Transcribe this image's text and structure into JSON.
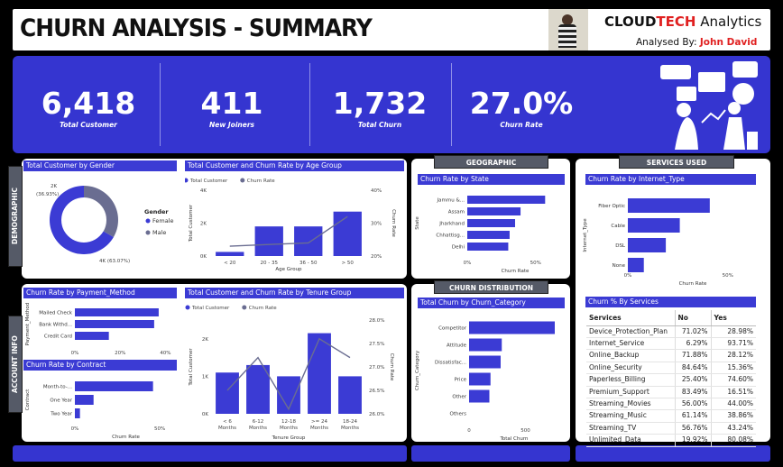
{
  "header": {
    "title": "CHURN ANALYSIS - SUMMARY",
    "brand_a": "CLOUD",
    "brand_b": "TECH",
    "brand_c": " Analytics",
    "analysed_by": "Analysed By: ",
    "analyst": "John David"
  },
  "kpis": [
    {
      "value": "6,418",
      "label": "Total Customer"
    },
    {
      "value": "411",
      "label": "New Joiners"
    },
    {
      "value": "1,732",
      "label": "Total Churn"
    },
    {
      "value": "27.0%",
      "label": "Churn Rate"
    }
  ],
  "sections": {
    "demographic": "DEMOGRAPHIC",
    "account_info": "ACCOUNT INFO",
    "geographic": "GEOGRAPHIC",
    "services_used": "SERVICES USED",
    "churn_distribution": "CHURN DISTRIBUTION"
  },
  "colors": {
    "primary": "#3b3bd4",
    "secondary": "#6a6d91",
    "header_text": "#111111",
    "accent_red": "#e02020"
  },
  "chart_data": [
    {
      "id": "gender",
      "type": "pie",
      "title": "Total Customer by Gender",
      "legend_title": "Gender",
      "categories": [
        "Female",
        "Male"
      ],
      "values": [
        4000,
        2000
      ],
      "percents": [
        "63.07%",
        "36.93%"
      ],
      "labels": [
        "4K (63.07%)",
        "2K (36.93%)"
      ]
    },
    {
      "id": "age",
      "type": "bar",
      "title": "Total Customer and Churn Rate by Age Group",
      "legend": [
        "Total Customer",
        "Churn Rate"
      ],
      "xlabel": "Age Group",
      "ylabel": "Total Customer",
      "y2label": "Churn Rate",
      "categories": [
        "< 20",
        "20 - 35",
        "36 - 50",
        "> 50"
      ],
      "series": [
        {
          "name": "Total Customer",
          "values": [
            250,
            1800,
            1800,
            2700
          ]
        },
        {
          "name": "Churn Rate",
          "values": [
            23,
            23.5,
            24,
            32
          ]
        }
      ],
      "ylim": [
        0,
        4000
      ],
      "yticks": [
        "0K",
        "2K",
        "4K"
      ],
      "y2lim": [
        20,
        40
      ],
      "y2ticks": [
        "20%",
        "30%",
        "40%"
      ]
    },
    {
      "id": "state",
      "type": "bar",
      "orientation": "horizontal",
      "title": "Churn Rate by State",
      "xlabel": "Churn Rate",
      "ylabel": "State",
      "categories": [
        "Jammu &...",
        "Assam",
        "Jharkhand",
        "Chhattisg...",
        "Delhi"
      ],
      "values": [
        57,
        39,
        35,
        31,
        30
      ],
      "xlim": [
        0,
        70
      ],
      "xticks": [
        "0%",
        "50%"
      ]
    },
    {
      "id": "internet",
      "type": "bar",
      "orientation": "horizontal",
      "title": "Churn Rate by Internet_Type",
      "xlabel": "Churn Rate",
      "ylabel": "Internet_Type",
      "categories": [
        "Fiber Optic",
        "Cable",
        "DSL",
        "None"
      ],
      "values": [
        41,
        26,
        19,
        8
      ],
      "xlim": [
        0,
        65
      ],
      "xticks": [
        "0%",
        "50%"
      ]
    },
    {
      "id": "payment",
      "type": "bar",
      "orientation": "horizontal",
      "title": "Churn Rate by Payment_Method",
      "ylabel": "Payment_Method",
      "categories": [
        "Mailed Check",
        "Bank Withd...",
        "Credit Card"
      ],
      "values": [
        37,
        35,
        15
      ],
      "xlim": [
        0,
        45
      ],
      "xticks": [
        "0%",
        "20%",
        "40%"
      ]
    },
    {
      "id": "contract",
      "type": "bar",
      "orientation": "horizontal",
      "title": "Churn Rate by Contract",
      "xlabel": "Churn Rate",
      "ylabel": "Contract",
      "categories": [
        "Month-to-...",
        "One Year",
        "Two Year"
      ],
      "values": [
        46,
        11,
        3
      ],
      "xlim": [
        0,
        60
      ],
      "xticks": [
        "0%",
        "50%"
      ]
    },
    {
      "id": "tenure",
      "type": "bar",
      "title": "Total Customer and Churn Rate by Tenure Group",
      "legend": [
        "Total Customer",
        "Churn Rate"
      ],
      "xlabel": "Tenure Group",
      "ylabel": "Total Customer",
      "y2label": "Churn Rate",
      "categories": [
        "< 6 Months",
        "6-12 Months",
        "12-18 Months",
        ">= 24 Months",
        "18-24 Months"
      ],
      "series": [
        {
          "name": "Total Customer",
          "values": [
            1100,
            1300,
            1000,
            2150,
            1000
          ]
        },
        {
          "name": "Churn Rate",
          "values": [
            26.5,
            27.2,
            26.1,
            27.6,
            27.2
          ]
        }
      ],
      "ylim": [
        0,
        2500
      ],
      "yticks": [
        "0K",
        "1K",
        "2K"
      ],
      "y2lim": [
        26,
        28
      ],
      "y2ticks": [
        "26.0%",
        "26.5%",
        "27.0%",
        "27.5%",
        "28.0%"
      ]
    },
    {
      "id": "category",
      "type": "bar",
      "orientation": "horizontal",
      "title": "Total Churn by Churn_Category",
      "xlabel": "Total Churn",
      "ylabel": "Churn_Category",
      "categories": [
        "Competitor",
        "Attitude",
        "Dissatisfac...",
        "Price",
        "Other",
        "Others"
      ],
      "values": [
        760,
        290,
        280,
        190,
        180,
        0
      ],
      "xlim": [
        0,
        800
      ],
      "xticks": [
        "0",
        "500"
      ]
    }
  ],
  "services_table": {
    "title": "Churn % By Services",
    "columns": [
      "Services",
      "No",
      "Yes"
    ],
    "rows": [
      [
        "Device_Protection_Plan",
        "71.02%",
        "28.98%"
      ],
      [
        "Internet_Service",
        "6.29%",
        "93.71%"
      ],
      [
        "Online_Backup",
        "71.88%",
        "28.12%"
      ],
      [
        "Online_Security",
        "84.64%",
        "15.36%"
      ],
      [
        "Paperless_Billing",
        "25.40%",
        "74.60%"
      ],
      [
        "Premium_Support",
        "83.49%",
        "16.51%"
      ],
      [
        "Streaming_Movies",
        "56.00%",
        "44.00%"
      ],
      [
        "Streaming_Music",
        "61.14%",
        "38.86%"
      ],
      [
        "Streaming_TV",
        "56.76%",
        "43.24%"
      ],
      [
        "Unlimited_Data",
        "19.92%",
        "80.08%"
      ]
    ]
  }
}
